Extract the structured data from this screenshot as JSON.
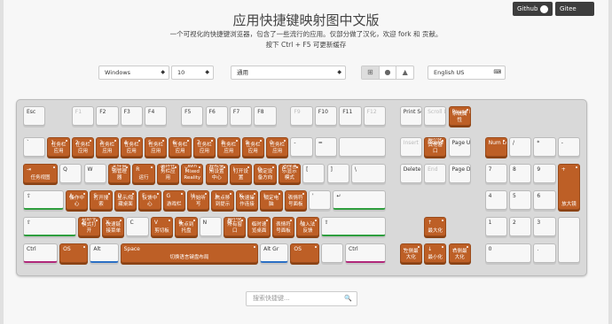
{
  "header": {
    "github": "Github",
    "gitee": "Gitee",
    "title": "应用快捷键映射图中文版",
    "subtitle": "一个可视化的快捷键浏览器，包含了一些流行的应用。仅部分做了汉化，欢迎 fork 和 贡献。",
    "hint": "按下 Ctrl + F5 可更新缓存"
  },
  "controls": {
    "os_select": "Windows",
    "version_select": "10",
    "app_select": "通用",
    "layout_select": "English US",
    "os_icons": [
      "windows-icon",
      "apple-icon",
      "linux-icon"
    ]
  },
  "keyboard": {
    "row1": [
      {
        "t": "Esc",
        "c": ""
      },
      {
        "t": "F1",
        "c": "",
        "d": true
      },
      {
        "t": "F2",
        "c": ""
      },
      {
        "t": "F3",
        "c": ""
      },
      {
        "t": "F4",
        "c": ""
      },
      {
        "t": "F5",
        "c": ""
      },
      {
        "t": "F6",
        "c": ""
      },
      {
        "t": "F7",
        "c": ""
      },
      {
        "t": "F8",
        "c": ""
      },
      {
        "t": "F9",
        "c": "",
        "d": true
      },
      {
        "t": "F10",
        "c": ""
      },
      {
        "t": "F11",
        "c": ""
      },
      {
        "t": "F12",
        "c": "",
        "d": true
      },
      {
        "t": "Print Screen",
        "c": ""
      },
      {
        "t": "Scroll Lock",
        "c": "",
        "d": true
      },
      {
        "t": "Pause Break",
        "c": "系统属性",
        "o": true
      }
    ],
    "row2": [
      {
        "t": "`",
        "c": ""
      },
      {
        "t": "1",
        "c": "任务栏应用",
        "o": true
      },
      {
        "t": "2",
        "c": "任务栏应用",
        "o": true
      },
      {
        "t": "3",
        "c": "任务栏应用",
        "o": true
      },
      {
        "t": "4",
        "c": "任务栏应用",
        "o": true
      },
      {
        "t": "5",
        "c": "任务栏应用",
        "o": true
      },
      {
        "t": "6",
        "c": "任务栏应用",
        "o": true
      },
      {
        "t": "7",
        "c": "任务栏应用",
        "o": true
      },
      {
        "t": "8",
        "c": "任务栏应用",
        "o": true
      },
      {
        "t": "9",
        "c": "任务栏应用",
        "o": true
      },
      {
        "t": "0",
        "c": "任务栏应用",
        "o": true
      },
      {
        "t": "-",
        "c": ""
      },
      {
        "t": "=",
        "c": ""
      },
      {
        "t": "",
        "c": ""
      },
      {
        "t": "Insert",
        "c": "",
        "d": true
      },
      {
        "t": "Home",
        "c": "最小化其他窗口",
        "o": true
      },
      {
        "t": "Page Up",
        "c": ""
      },
      {
        "t": "Num Lock",
        "c": "",
        "o": true
      },
      {
        "t": "/",
        "c": ""
      },
      {
        "t": "*",
        "c": ""
      },
      {
        "t": "-",
        "c": ""
      }
    ],
    "row3": [
      {
        "t": "⇥",
        "c": "任务视图",
        "o": true
      },
      {
        "t": "Q",
        "c": ""
      },
      {
        "t": "W",
        "c": ""
      },
      {
        "t": "E",
        "c": "文件资源管理器",
        "o": true
      },
      {
        "t": "R",
        "c": "运行",
        "o": true
      },
      {
        "t": "T",
        "c": "循环任务栏应用",
        "o": true
      },
      {
        "t": "Y",
        "c": "Win Mixed Reality",
        "o": true
      },
      {
        "t": "U",
        "c": "轻松使用设置中心",
        "o": true
      },
      {
        "t": "I",
        "c": "打开设置",
        "o": true
      },
      {
        "t": "O",
        "c": "锁定设备方向",
        "o": true
      },
      {
        "t": "P",
        "c": "选择演示显示模式",
        "o": true
      },
      {
        "t": "[",
        "c": ""
      },
      {
        "t": "]",
        "c": ""
      },
      {
        "t": "\\",
        "c": ""
      },
      {
        "t": "Delete",
        "c": ""
      },
      {
        "t": "End",
        "c": "",
        "d": true
      },
      {
        "t": "Page Down",
        "c": ""
      },
      {
        "t": "7",
        "c": ""
      },
      {
        "t": "8",
        "c": ""
      },
      {
        "t": "9",
        "c": ""
      },
      {
        "t": "+",
        "c": "放大镜",
        "o": true
      }
    ],
    "row4": [
      {
        "t": "⇪",
        "c": ""
      },
      {
        "t": "A",
        "c": "操作中心",
        "o": true
      },
      {
        "t": "S",
        "c": "打开搜索",
        "o": true
      },
      {
        "t": "D",
        "c": "显示/隐藏桌面",
        "o": true
      },
      {
        "t": "F",
        "c": "反馈中心",
        "o": true
      },
      {
        "t": "G",
        "c": "游戏栏",
        "o": true
      },
      {
        "t": "H",
        "c": "开始听写",
        "o": true
      },
      {
        "t": "J",
        "c": "焦点移到提示",
        "o": true
      },
      {
        "t": "K",
        "c": "快速操作连接",
        "o": true
      },
      {
        "t": "L",
        "c": "锁定电脑",
        "o": true
      },
      {
        "t": ";",
        "c": "表情符号面板",
        "o": true
      },
      {
        "t": "'",
        "c": ""
      },
      {
        "t": "↵",
        "c": ""
      },
      {
        "t": "4",
        "c": ""
      },
      {
        "t": "5",
        "c": ""
      },
      {
        "t": "6",
        "c": ""
      }
    ],
    "row5": [
      {
        "t": "⇧",
        "c": ""
      },
      {
        "t": "Z",
        "c": "以命令模式打开",
        "o": true
      },
      {
        "t": "X",
        "c": "快速链接菜单",
        "o": true
      },
      {
        "t": "C",
        "c": "",
        "o": false
      },
      {
        "t": "V",
        "c": "剪切板",
        "o": true
      },
      {
        "t": "B",
        "c": "焦点到托盘",
        "o": true
      },
      {
        "t": "N",
        "c": ""
      },
      {
        "t": "M",
        "c": "最小化所有窗口",
        "o": true
      },
      {
        "t": ",",
        "c": "临时速览桌面",
        "o": true
      },
      {
        "t": ".",
        "c": "表情符号面板",
        "o": true
      },
      {
        "t": "/",
        "c": "输入法反馈",
        "o": true
      },
      {
        "t": "⇧",
        "c": ""
      },
      {
        "t": "↑",
        "c": "最大化",
        "o": true
      },
      {
        "t": "1",
        "c": ""
      },
      {
        "t": "2",
        "c": ""
      },
      {
        "t": "3",
        "c": ""
      },
      {
        "t": "",
        "c": ""
      }
    ],
    "row6": [
      {
        "t": "Ctrl",
        "c": ""
      },
      {
        "t": "OS",
        "c": "",
        "o": true
      },
      {
        "t": "Alt",
        "c": ""
      },
      {
        "t": "Space",
        "c": "切换语言键盘布局",
        "o": true
      },
      {
        "t": "Alt Gr",
        "c": ""
      },
      {
        "t": "OS",
        "c": "",
        "o": true
      },
      {
        "t": "",
        "c": ""
      },
      {
        "t": "Ctrl",
        "c": ""
      },
      {
        "t": "←",
        "c": "左侧最大化",
        "o": true
      },
      {
        "t": "↓",
        "c": "最小化",
        "o": true
      },
      {
        "t": "→",
        "c": "右侧最大化",
        "o": true
      },
      {
        "t": "0",
        "c": ""
      },
      {
        "t": ".",
        "c": ""
      }
    ]
  },
  "search": {
    "placeholder": "搜索快捷键..."
  }
}
